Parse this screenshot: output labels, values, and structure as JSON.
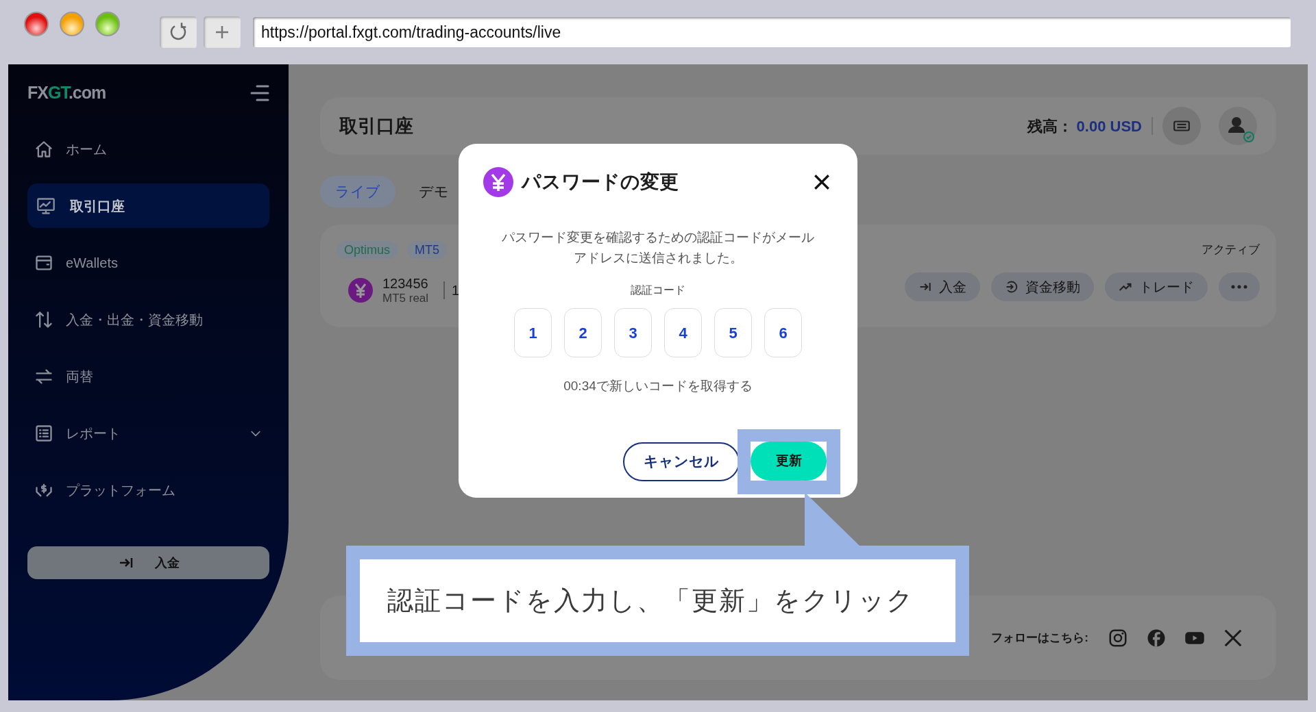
{
  "browser": {
    "url": "https://portal.fxgt.com/trading-accounts/live"
  },
  "sidebar": {
    "logo": [
      {
        "text": "FX",
        "accent": false
      },
      {
        "text": "GT",
        "accent": true
      },
      {
        "text": ".com",
        "accent": false
      }
    ],
    "items": [
      {
        "label": "ホーム",
        "selected": false,
        "kind": "link"
      },
      {
        "label": "取引口座",
        "selected": true,
        "kind": "link"
      },
      {
        "label": "eWallets",
        "selected": false,
        "kind": "link"
      },
      {
        "label": "入金・出金・資金移動",
        "selected": false,
        "kind": "link"
      },
      {
        "label": "両替",
        "selected": false,
        "kind": "link"
      },
      {
        "label": "レポート",
        "selected": false,
        "kind": "group"
      },
      {
        "label": "プラットフォーム",
        "selected": false,
        "kind": "link"
      }
    ],
    "deposit_button": "入金"
  },
  "header": {
    "title": "取引口座",
    "balance_label": "残高：",
    "balance_value": "0.00 USD"
  },
  "tabs": [
    {
      "label": "ライブ",
      "selected": true
    },
    {
      "label": "デモ",
      "selected": false
    }
  ],
  "account": {
    "tags": [
      {
        "text": "Optimus",
        "color": "#1f6b4e"
      },
      {
        "text": "MT5",
        "color": "#1e3a8a"
      }
    ],
    "number": "123456",
    "type": "MT5 real",
    "column_3": "1",
    "status": "アクティブ",
    "actions": [
      {
        "label": "入金",
        "kind": "deposit"
      },
      {
        "label": "資金移動",
        "kind": "transfer"
      },
      {
        "label": "トレード",
        "kind": "trade"
      },
      {
        "kind": "more"
      }
    ]
  },
  "footer": {
    "follow_label": "フォローはこちら:"
  },
  "modal": {
    "title": "パスワードの変更",
    "description": "パスワード変更を確認するための認証コードがメールアドレスに送信されました。",
    "code_label": "認証コード",
    "code_digits": [
      "1",
      "2",
      "3",
      "4",
      "5",
      "6"
    ],
    "timer": "00:34で新しいコードを取得する",
    "cancel": "キャンセル",
    "submit": "更新"
  },
  "callout": {
    "text": "認証コードを入力し、「更新」をクリック"
  }
}
